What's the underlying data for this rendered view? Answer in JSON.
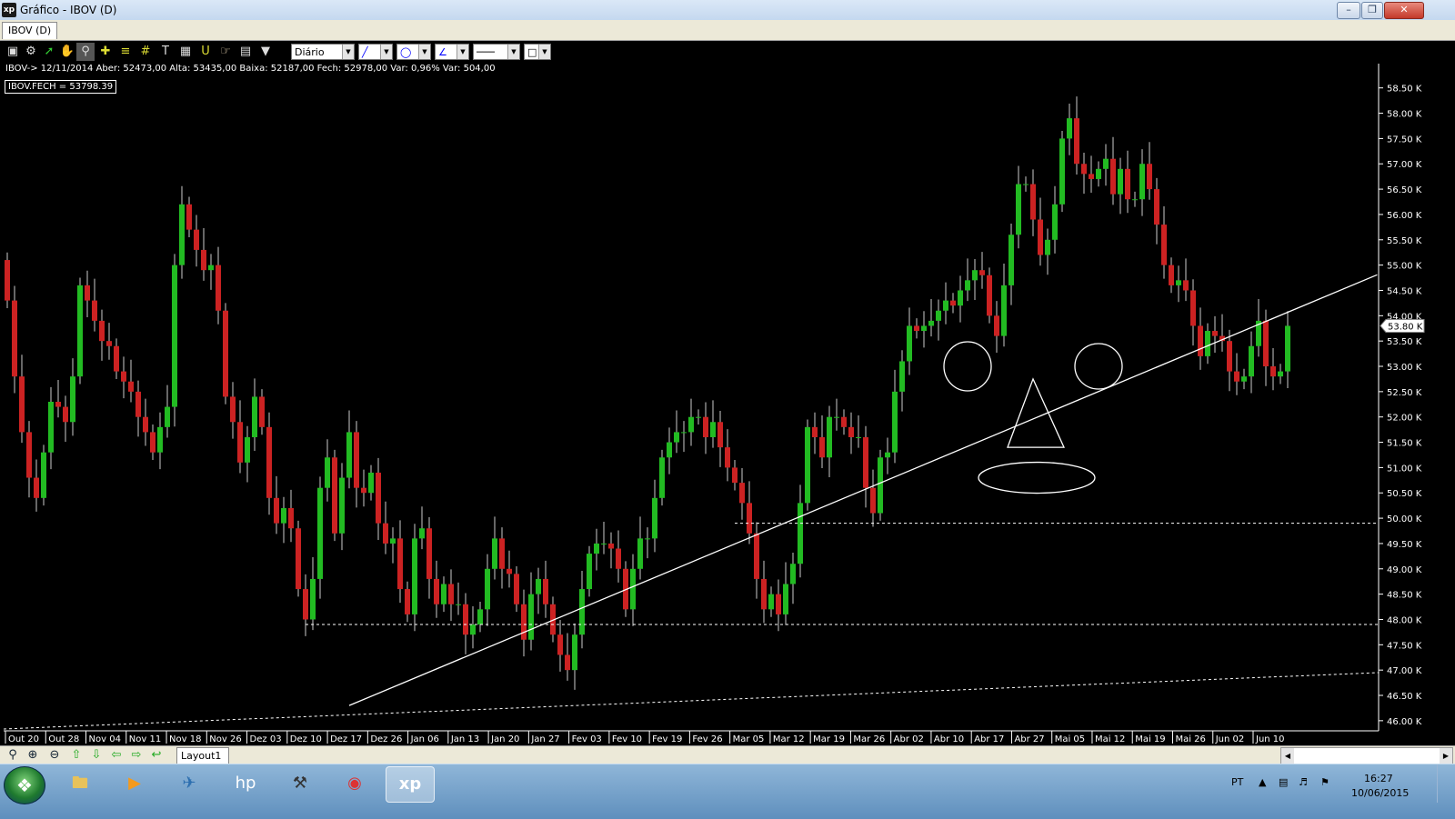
{
  "window": {
    "title": "Gráfico - IBOV (D)",
    "app_icon": "xp",
    "buttons": [
      "minimize-icon",
      "restore-icon",
      "close-icon"
    ]
  },
  "tab": {
    "label": "IBOV (D)"
  },
  "toolbar": {
    "icons": [
      "chart-type-icon",
      "gear-icon",
      "cursor-icon",
      "hand-icon",
      "zoom-area-icon",
      "crosshair-icon",
      "hline-icon",
      "grid-icon",
      "text-icon",
      "calculator-icon",
      "magnet-icon",
      "hand-pointer-icon",
      "clipboard-icon",
      "filter-icon"
    ],
    "period": "Diário"
  },
  "info_line": "IBOV-> 12/11/2014 Aber: 52473,00 Alta: 53435,00 Baixa: 52187,00 Fech: 52978,00 Var: 0,96% Var: 504,00",
  "series_label": "IBOV.FECH = 53798.39",
  "current_value_label": "53.80 K",
  "bottom": {
    "layout_tab": "Layout1",
    "icons": [
      "zoom-icon",
      "zoom-in-icon",
      "zoom-out-icon",
      "arrow-up-icon",
      "arrow-down-icon",
      "arrow-left-icon",
      "arrow-right-icon",
      "arrow-back-icon"
    ]
  },
  "taskbar": {
    "apps": [
      "explorer-icon",
      "media-player-icon",
      "network-icon",
      "hp-icon",
      "tool-icon",
      "chrome-icon",
      "xp-icon"
    ],
    "lang": "PT",
    "time": "16:27",
    "date": "10/06/2015"
  },
  "colors": {
    "up": "#22bb22",
    "down": "#cc2222",
    "background": "#000000",
    "lines": "#ffffff"
  },
  "chart_data": {
    "type": "candlestick",
    "y_unit": "K",
    "ylim": [
      45.8,
      58.8
    ],
    "y_ticks": [
      46.0,
      46.5,
      47.0,
      47.5,
      48.0,
      48.5,
      49.0,
      49.5,
      50.0,
      50.5,
      51.0,
      51.5,
      52.0,
      52.5,
      53.0,
      53.5,
      54.0,
      54.5,
      55.0,
      55.5,
      56.0,
      56.5,
      57.0,
      57.5,
      58.0,
      58.5
    ],
    "y_tick_labels": [
      "46.00 K",
      "46.50 K",
      "47.00 K",
      "47.50 K",
      "48.00 K",
      "48.50 K",
      "49.00 K",
      "49.50 K",
      "50.00 K",
      "50.50 K",
      "51.00 K",
      "51.50 K",
      "52.00 K",
      "52.50 K",
      "53.00 K",
      "53.50 K",
      "54.00 K",
      "54.50 K",
      "55.00 K",
      "55.50 K",
      "56.00 K",
      "56.50 K",
      "57.00 K",
      "57.50 K",
      "58.00 K",
      "58.50 K"
    ],
    "x_tick_labels": [
      "Out 20",
      "Out 28",
      "Nov 04",
      "Nov 11",
      "Nov 18",
      "Nov 26",
      "Dez 03",
      "Dez 10",
      "Dez 17",
      "Dez 26",
      "Jan 06",
      "Jan 13",
      "Jan 20",
      "Jan 27",
      "Fev 03",
      "Fev 10",
      "Fev 19",
      "Fev 26",
      "Mar 05",
      "Mar 12",
      "Mar 19",
      "Mar 26",
      "Abr 02",
      "Abr 10",
      "Abr 17",
      "Abr 27",
      "Mai 05",
      "Mai 12",
      "Mai 19",
      "Mai 26",
      "Jun 02",
      "Jun 10"
    ],
    "closes": [
      54.3,
      52.8,
      51.7,
      50.8,
      50.4,
      51.3,
      52.3,
      52.2,
      51.9,
      52.8,
      54.6,
      54.3,
      53.9,
      53.5,
      53.4,
      52.9,
      52.7,
      52.5,
      52.0,
      51.7,
      51.3,
      51.8,
      52.2,
      55.0,
      56.2,
      55.7,
      55.3,
      54.9,
      55.0,
      54.1,
      52.4,
      51.9,
      51.1,
      51.6,
      52.4,
      51.8,
      50.4,
      49.9,
      50.2,
      49.8,
      48.6,
      48.0,
      48.8,
      50.6,
      51.2,
      49.7,
      50.8,
      51.7,
      50.6,
      50.5,
      50.9,
      49.9,
      49.5,
      49.6,
      48.6,
      48.1,
      49.6,
      49.8,
      48.8,
      48.3,
      48.7,
      48.3,
      48.3,
      47.7,
      47.9,
      48.2,
      49.0,
      49.6,
      49.0,
      48.9,
      48.3,
      47.6,
      48.5,
      48.8,
      48.3,
      47.7,
      47.3,
      47.0,
      47.7,
      48.6,
      49.3,
      49.5,
      49.5,
      49.4,
      49.0,
      48.2,
      49.0,
      49.6,
      49.6,
      50.4,
      51.2,
      51.5,
      51.7,
      51.7,
      52.0,
      52.0,
      51.6,
      51.9,
      51.4,
      51.0,
      50.7,
      50.3,
      49.7,
      48.8,
      48.2,
      48.5,
      48.1,
      48.7,
      49.1,
      50.3,
      51.8,
      51.6,
      51.2,
      52.0,
      52.0,
      51.8,
      51.6,
      51.6,
      50.6,
      50.1,
      51.2,
      51.3,
      52.5,
      53.1,
      53.8,
      53.7,
      53.8,
      53.9,
      54.1,
      54.3,
      54.2,
      54.5,
      54.7,
      54.9,
      54.8,
      54.0,
      53.6,
      54.6,
      55.6,
      56.6,
      56.6,
      55.9,
      55.2,
      55.5,
      56.2,
      57.5,
      57.9,
      57.0,
      56.8,
      56.7,
      56.9,
      57.1,
      56.4,
      56.9,
      56.3,
      56.3,
      57.0,
      56.5,
      55.8,
      55.0,
      54.6,
      54.7,
      54.5,
      53.8,
      53.2,
      53.7,
      53.6,
      53.5,
      52.9,
      52.7,
      52.8,
      53.4,
      53.9,
      53.0,
      52.8,
      52.9,
      53.8
    ],
    "annotations": {
      "trendline": [
        [
          47.0,
          46.3
        ],
        [
          140.0,
          51.9
        ]
      ],
      "support_lines": [
        {
          "y": 49.9,
          "from": 100
        },
        {
          "y": 47.9,
          "from": 41
        }
      ],
      "face_drawing": true
    }
  }
}
